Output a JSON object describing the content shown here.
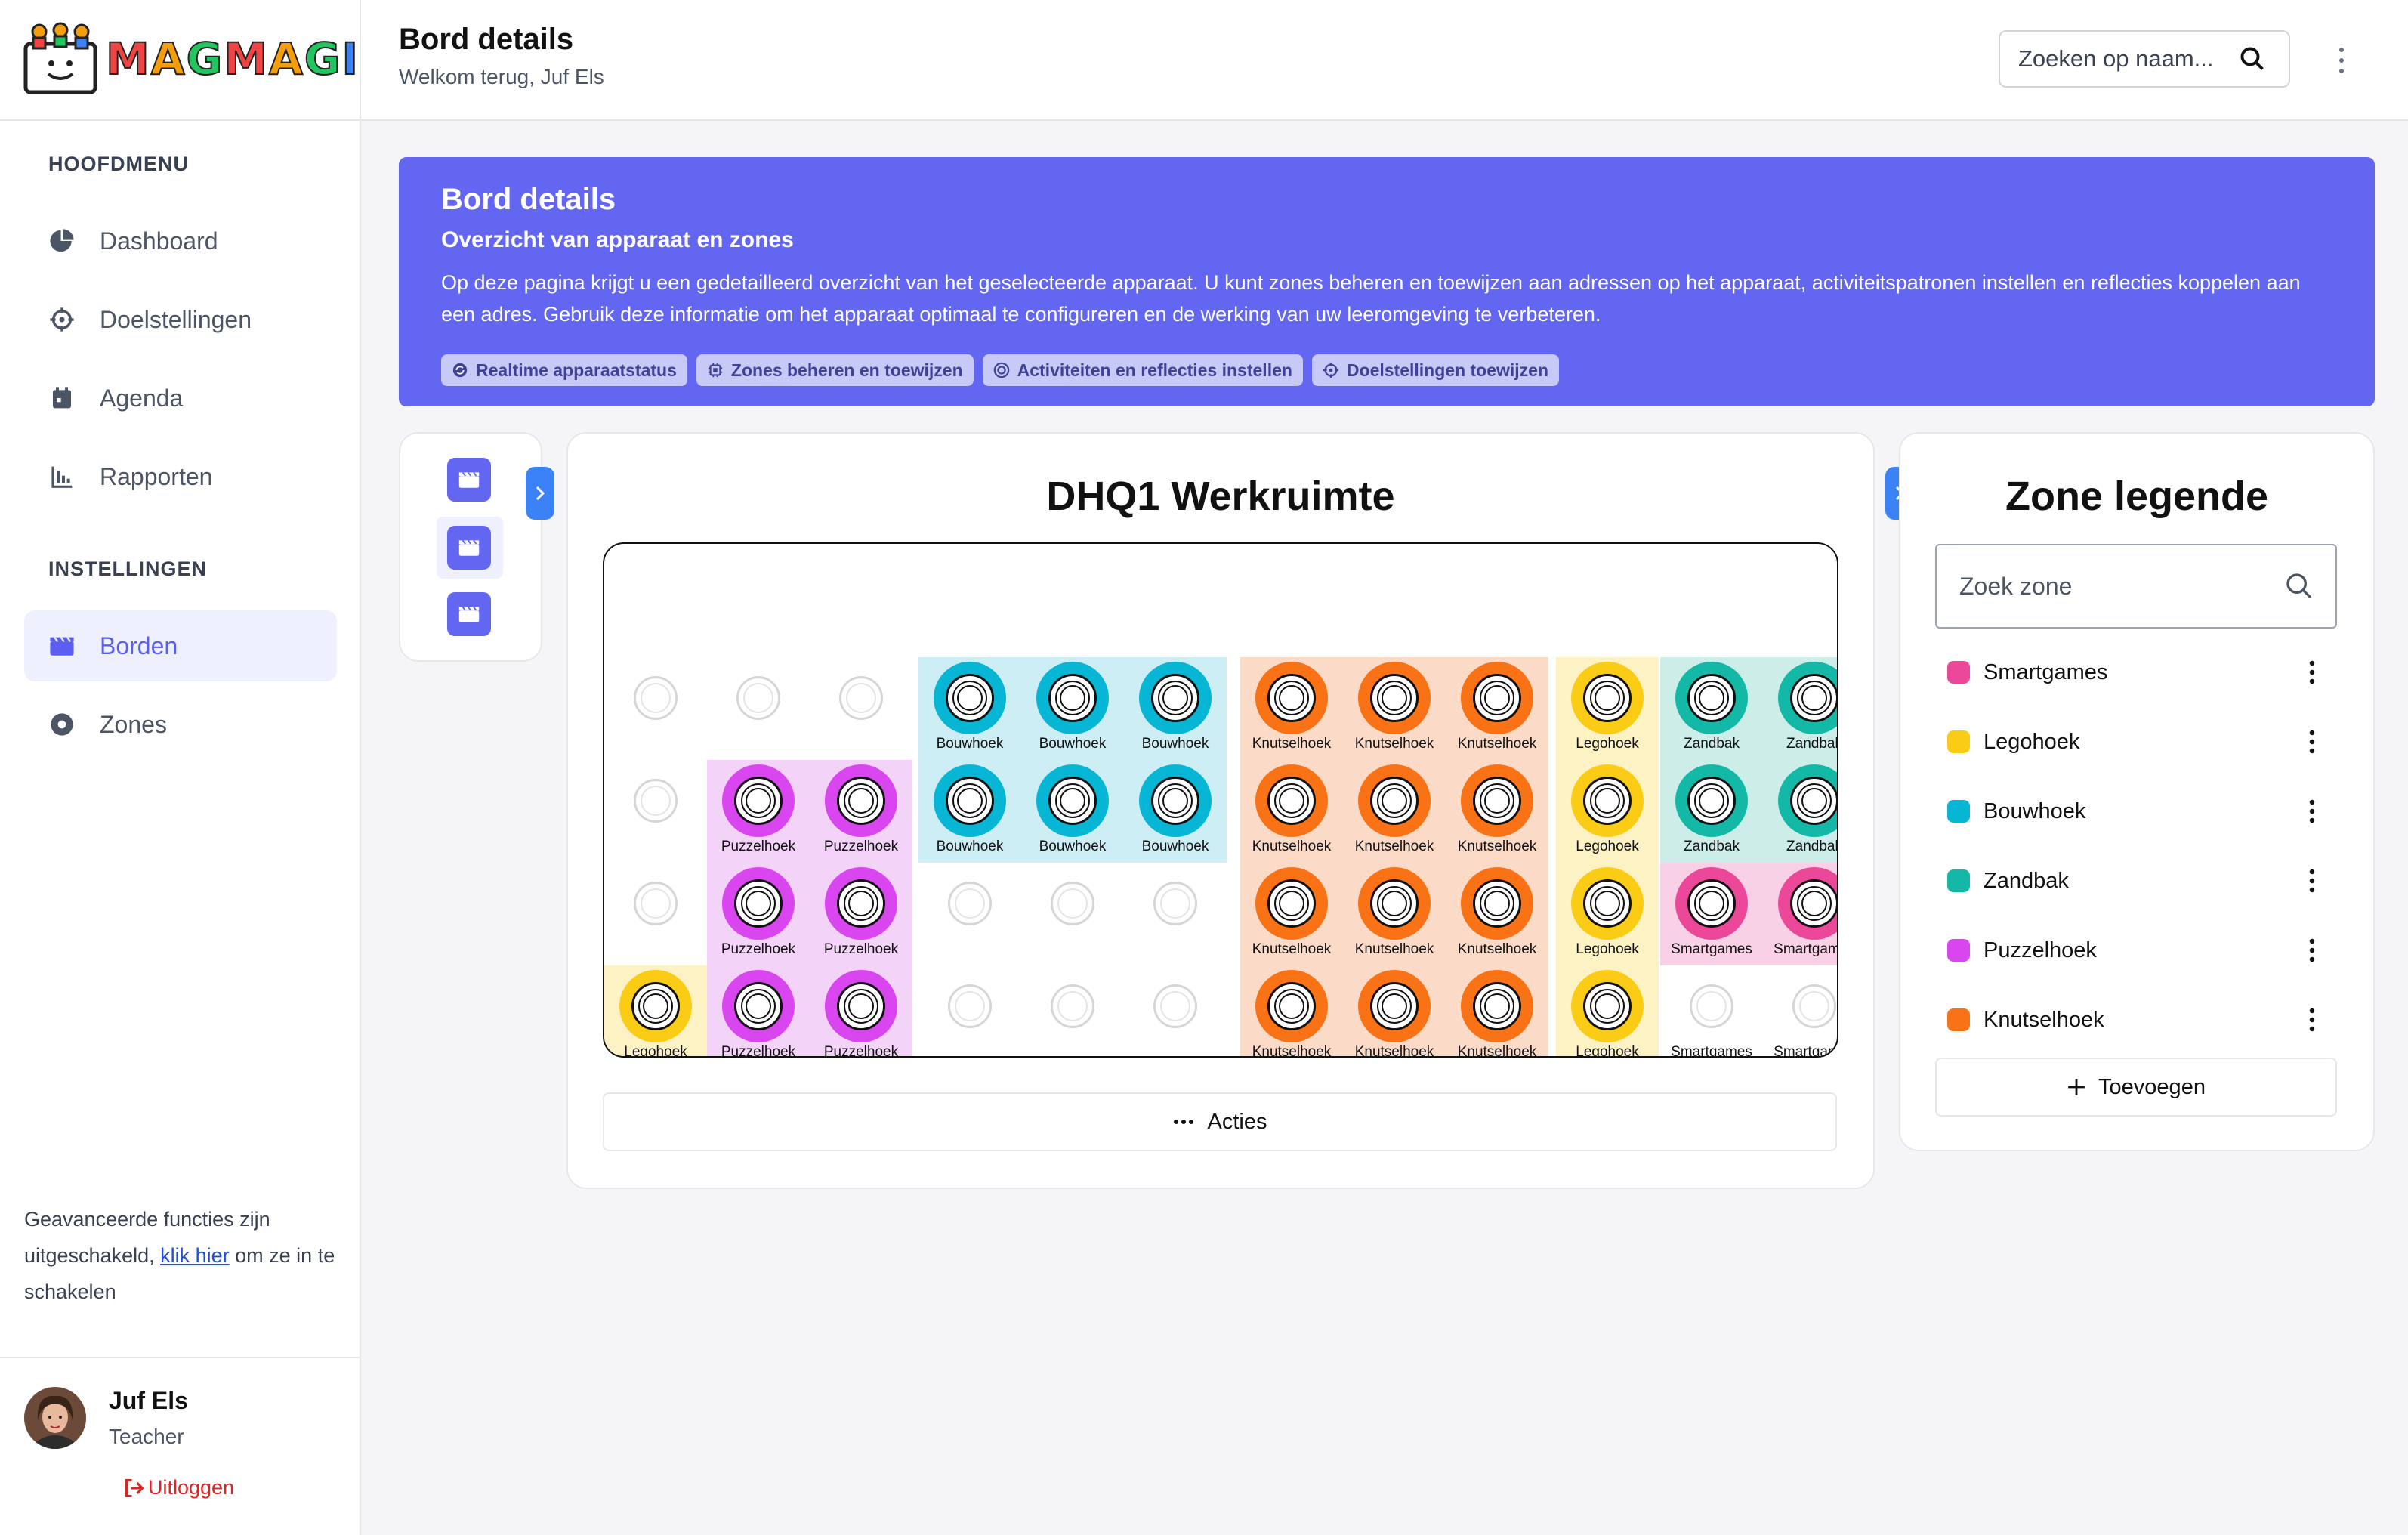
{
  "app": {
    "brand": "MAGMAGI"
  },
  "sidebar": {
    "main_title": "HOOFDMENU",
    "main_items": [
      {
        "label": "Dashboard",
        "icon": "pie-chart-icon"
      },
      {
        "label": "Doelstellingen",
        "icon": "crosshair-icon"
      },
      {
        "label": "Agenda",
        "icon": "calendar-icon"
      },
      {
        "label": "Rapporten",
        "icon": "bar-chart-icon"
      }
    ],
    "settings_title": "INSTELLINGEN",
    "settings_items": [
      {
        "label": "Borden",
        "icon": "clapperboard-icon",
        "active": true
      },
      {
        "label": "Zones",
        "icon": "dot-circle-icon"
      }
    ],
    "advanced_before": "Geavanceerde functies zijn uitgeschakeld, ",
    "advanced_link": "klik hier",
    "advanced_after": " om ze in te schakelen",
    "user_name": "Juf Els",
    "user_role": "Teacher",
    "logout": "Uitloggen"
  },
  "header": {
    "title": "Bord details",
    "subtitle": "Welkom terug, Juf Els",
    "search_placeholder": "Zoeken op naam..."
  },
  "banner": {
    "title": "Bord details",
    "subtitle": "Overzicht van apparaat en zones",
    "description": "Op deze pagina krijgt u een gedetailleerd overzicht van het geselecteerde apparaat. U kunt zones beheren en toewijzen aan adressen op het apparaat, activiteitspatronen instellen en reflecties koppelen aan een adres. Gebruik deze informatie om het apparaat optimaal te configureren en de werking van uw leeromgeving te verbeteren.",
    "chips": [
      "Realtime apparaatstatus",
      "Zones beheren en toewijzen",
      "Activiteiten en reflecties instellen",
      "Doelstellingen toewijzen"
    ]
  },
  "workspace": {
    "title": "DHQ1 Werkruimte",
    "actions_label": "Acties",
    "grid": [
      [
        null,
        null,
        null,
        "Bouwhoek",
        "Bouwhoek",
        "Bouwhoek",
        "Knutselhoek",
        "Knutselhoek",
        "Knutselhoek",
        "Legohoek",
        "Zandbak",
        "Zandbak"
      ],
      [
        null,
        "Puzzelhoek",
        "Puzzelhoek",
        "Bouwhoek",
        "Bouwhoek",
        "Bouwhoek",
        "Knutselhoek",
        "Knutselhoek",
        "Knutselhoek",
        "Legohoek",
        "Zandbak",
        "Zandbak"
      ],
      [
        null,
        "Puzzelhoek",
        "Puzzelhoek",
        null,
        null,
        null,
        "Knutselhoek",
        "Knutselhoek",
        "Knutselhoek",
        "Legohoek",
        "Smartgames",
        "Smartgames"
      ],
      [
        "Legohoek",
        "Puzzelhoek",
        "Puzzelhoek",
        null,
        null,
        null,
        "Knutselhoek",
        "Knutselhoek",
        "Knutselhoek",
        "Legohoek",
        "Smartgames:empty",
        "Smartgames:empty"
      ]
    ]
  },
  "legend": {
    "title": "Zone legende",
    "search_placeholder": "Zoek zone",
    "add_label": "Toevoegen",
    "zones": [
      {
        "name": "Smartgames",
        "color": "#ec4899",
        "bg": "#f9d1e6"
      },
      {
        "name": "Legohoek",
        "color": "#facc15",
        "bg": "#fdf2c4"
      },
      {
        "name": "Bouwhoek",
        "color": "#06b6d4",
        "bg": "#cdeef5"
      },
      {
        "name": "Zandbak",
        "color": "#14b8a6",
        "bg": "#cdeee8"
      },
      {
        "name": "Puzzelhoek",
        "color": "#d946ef",
        "bg": "#f3d3f8"
      },
      {
        "name": "Knutselhoek",
        "color": "#f97316",
        "bg": "#fbdac7"
      }
    ]
  }
}
